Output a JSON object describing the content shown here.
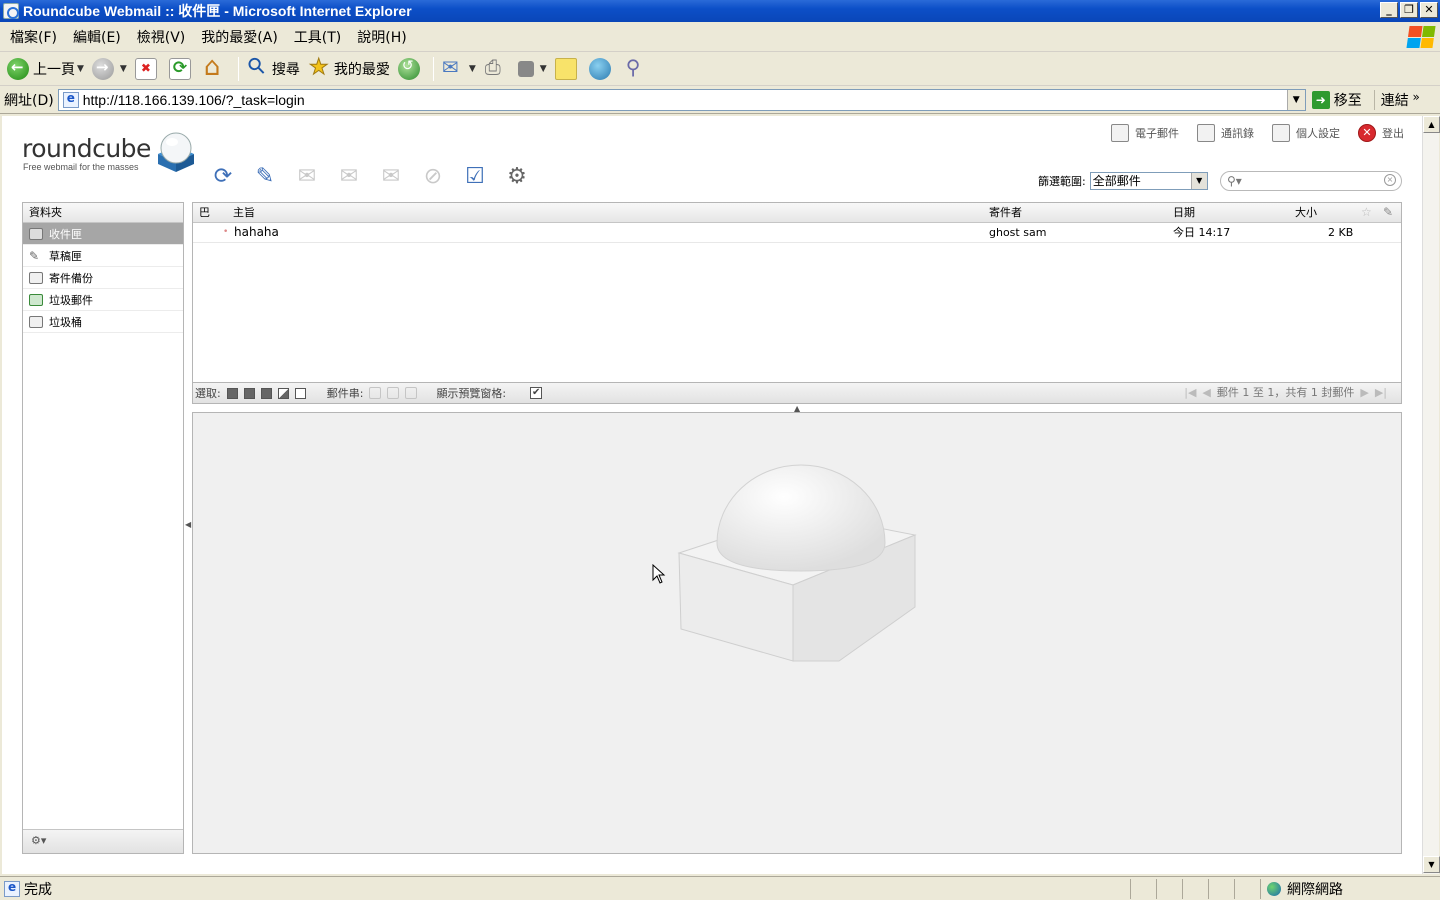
{
  "window": {
    "title": "Roundcube Webmail :: 收件匣 - Microsoft Internet Explorer",
    "controls": [
      "_",
      "❐",
      "✕"
    ]
  },
  "menubar": [
    "檔案(F)",
    "編輯(E)",
    "檢視(V)",
    "我的最愛(A)",
    "工具(T)",
    "說明(H)"
  ],
  "ie_toolbar": {
    "back_label": "上一頁",
    "search_label": "搜尋",
    "favorites_label": "我的最愛"
  },
  "address": {
    "label": "網址(D)",
    "url": "http://118.166.139.106/?_task=login",
    "go_label": "移至",
    "links_label": "連結"
  },
  "status": {
    "text": "完成",
    "zone": "網際網路"
  },
  "roundcube": {
    "logo": {
      "wordmark": "roundcube",
      "tagline": "Free webmail for the masses"
    },
    "tasks": [
      {
        "label": "電子郵件",
        "icon": "mail-download-icon"
      },
      {
        "label": "通訊錄",
        "icon": "address-book-icon"
      },
      {
        "label": "個人設定",
        "icon": "settings-icon"
      },
      {
        "label": "登出",
        "icon": "logout-icon"
      }
    ],
    "toolbar_icons": [
      "check-mail-icon",
      "compose-icon",
      "reply-icon",
      "reply-all-icon",
      "forward-icon",
      "delete-icon",
      "mark-icon",
      "more-actions-icon"
    ],
    "filter": {
      "label": "篩選範圍:",
      "selected": "全部郵件"
    },
    "search": {
      "placeholder": ""
    },
    "folders": {
      "title": "資料夾",
      "items": [
        {
          "label": "收件匣",
          "selected": true
        },
        {
          "label": "草稿匣",
          "selected": false
        },
        {
          "label": "寄件備份",
          "selected": false
        },
        {
          "label": "垃圾郵件",
          "selected": false
        },
        {
          "label": "垃圾桶",
          "selected": false
        }
      ],
      "footer_icon": "⚙▾"
    },
    "messagelist": {
      "columns": {
        "threads": "巴",
        "subject": "主旨",
        "from": "寄件者",
        "date": "日期",
        "size": "大小"
      },
      "rows": [
        {
          "subject": "hahaha",
          "from": "ghost sam",
          "date": "今日 14:17",
          "size": "2 KB"
        }
      ]
    },
    "list_footer": {
      "select_label": "選取:",
      "threads_label": "郵件串:",
      "preview_label": "顯示預覽窗格:",
      "preview_checked": "✔",
      "pager_text": "郵件 1 至 1，共有 1 封郵件"
    }
  }
}
